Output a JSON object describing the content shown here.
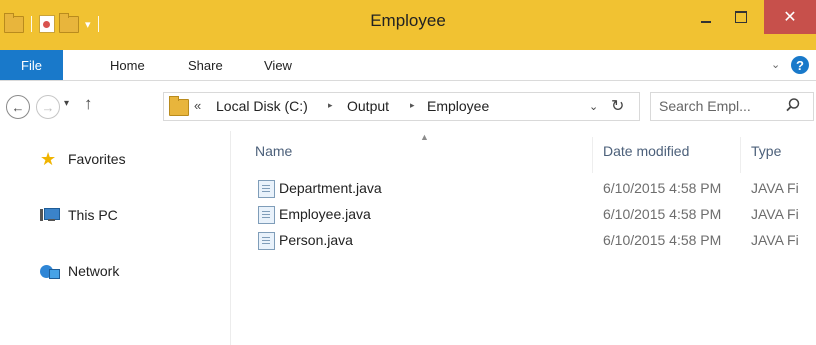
{
  "window": {
    "title": "Employee",
    "close_glyph": "✕"
  },
  "quick_access": {
    "dropdown_glyph": "▾"
  },
  "ribbon": {
    "file_tab": "File",
    "tabs": [
      "Home",
      "Share",
      "View"
    ],
    "collapse_glyph": "⌄",
    "help_glyph": "?"
  },
  "nav": {
    "back_glyph": "←",
    "forward_glyph": "→",
    "recent_glyph": "▾",
    "up_glyph": "↑",
    "overflow_glyph": "«",
    "breadcrumbs": [
      "Local Disk (C:)",
      "Output",
      "Employee"
    ],
    "separator_glyph": "▸",
    "dropdown_glyph": "⌄",
    "refresh_glyph": "↻"
  },
  "search": {
    "placeholder": "Search Empl..."
  },
  "navpane": {
    "favorites": "Favorites",
    "this_pc": "This PC",
    "network": "Network"
  },
  "list": {
    "sort_glyph": "▲",
    "columns": {
      "name": "Name",
      "date": "Date modified",
      "type": "Type"
    },
    "files": [
      {
        "name": "Department.java",
        "date": "6/10/2015 4:58 PM",
        "type": "JAVA Fi"
      },
      {
        "name": "Employee.java",
        "date": "6/10/2015 4:58 PM",
        "type": "JAVA Fi"
      },
      {
        "name": "Person.java",
        "date": "6/10/2015 4:58 PM",
        "type": "JAVA Fi"
      }
    ]
  },
  "colors": {
    "titlebar": "#f1c232",
    "file_tab": "#1979ca",
    "close_button": "#c7504b",
    "column_header_text": "#4c607a"
  },
  "icons": [
    "folder-icon",
    "properties-icon",
    "star-icon",
    "computer-icon",
    "network-icon",
    "java-file-icon",
    "search-icon"
  ]
}
